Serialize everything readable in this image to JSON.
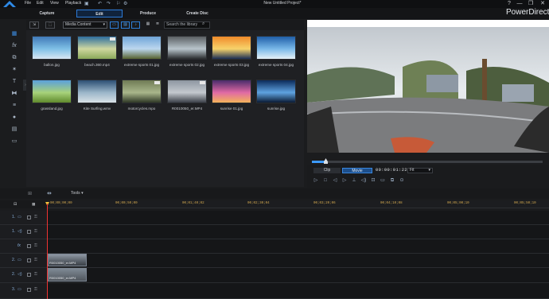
{
  "app": {
    "window_title": "New Untitled Project*",
    "brand": "PowerDirector",
    "menu": [
      "File",
      "Edit",
      "View",
      "Playback"
    ],
    "window_controls": [
      "?",
      "—",
      "❐",
      "✕"
    ]
  },
  "modes": {
    "tabs": [
      {
        "label": "Capture",
        "active": false
      },
      {
        "label": "Edit",
        "active": true
      },
      {
        "label": "Produce",
        "active": false
      },
      {
        "label": "Create Disc",
        "active": false
      }
    ]
  },
  "library": {
    "media_filter": "Media Content",
    "search_placeholder": "Search the library",
    "items": [
      {
        "name": "ballon.jpg",
        "colors": [
          "#3f78b8",
          "#7fc0e6",
          "#d9e7f2"
        ]
      },
      {
        "name": "beach.360.mp4",
        "colors": [
          "#2e6e9e",
          "#cfd7a0",
          "#8aa85a"
        ],
        "badge": "360"
      },
      {
        "name": "extreme sports 01.jpg",
        "colors": [
          "#6ea4d8",
          "#bcd7ee",
          "#57622f"
        ]
      },
      {
        "name": "extreme sports 02.jpg",
        "colors": [
          "#5a5f63",
          "#b9c5cc",
          "#2a2d2f"
        ]
      },
      {
        "name": "extreme sports 03.jpg",
        "colors": [
          "#f08a2a",
          "#f7d36b",
          "#1c2f54"
        ]
      },
      {
        "name": "extreme sports 04.jpg",
        "colors": [
          "#1f5ea8",
          "#79b8e8",
          "#e6f1f7"
        ]
      },
      {
        "name": "grassland.jpg",
        "colors": [
          "#5aa0dc",
          "#a7d27a",
          "#5f8a2c"
        ]
      },
      {
        "name": "Kite Surfing.wmv",
        "colors": [
          "#2c4f73",
          "#9bb6c9",
          "#d8e1e6"
        ]
      },
      {
        "name": "motorcycles.mpo",
        "colors": [
          "#6f7b55",
          "#a9b68b",
          "#2f3826"
        ],
        "badge": "3D"
      },
      {
        "name": "R0010050_er.MP4",
        "colors": [
          "#8d96a1",
          "#c4c9ce",
          "#3b4048"
        ],
        "badge": "360"
      },
      {
        "name": "sunrise 01.jpg",
        "colors": [
          "#4a2c6b",
          "#e06aa4",
          "#f3b35a"
        ]
      },
      {
        "name": "sunrise.jpg",
        "colors": [
          "#0b2a5a",
          "#5ea3e0",
          "#0a1a33"
        ]
      }
    ]
  },
  "preview": {
    "modes": [
      "Clip",
      "Movie"
    ],
    "active_mode": "Movie",
    "timecode": "00:00:01:22",
    "fit": "Fit",
    "scrub_progress": 0.06
  },
  "timeline": {
    "tools_label": "Tools",
    "ruler": [
      "00;00;00;00",
      "00;00;50;00",
      "00;01;40;02",
      "00;02;30;04",
      "00;03;20;06",
      "00;04;10;08",
      "00;05;00;10",
      "00;05;50;10",
      "00;06;40;12"
    ],
    "tracks": [
      {
        "label": "1.",
        "icon": "video-icon"
      },
      {
        "label": "1.",
        "icon": "audio-icon"
      },
      {
        "label": "",
        "icon": "fx-icon"
      },
      {
        "label": "2.",
        "icon": "video-icon"
      },
      {
        "label": "2.",
        "icon": "audio-icon"
      },
      {
        "label": "3.",
        "icon": "video-icon"
      }
    ],
    "clip_video": "R0010050_er.MP4",
    "clip_audio": "R0010050_er.MP4"
  }
}
